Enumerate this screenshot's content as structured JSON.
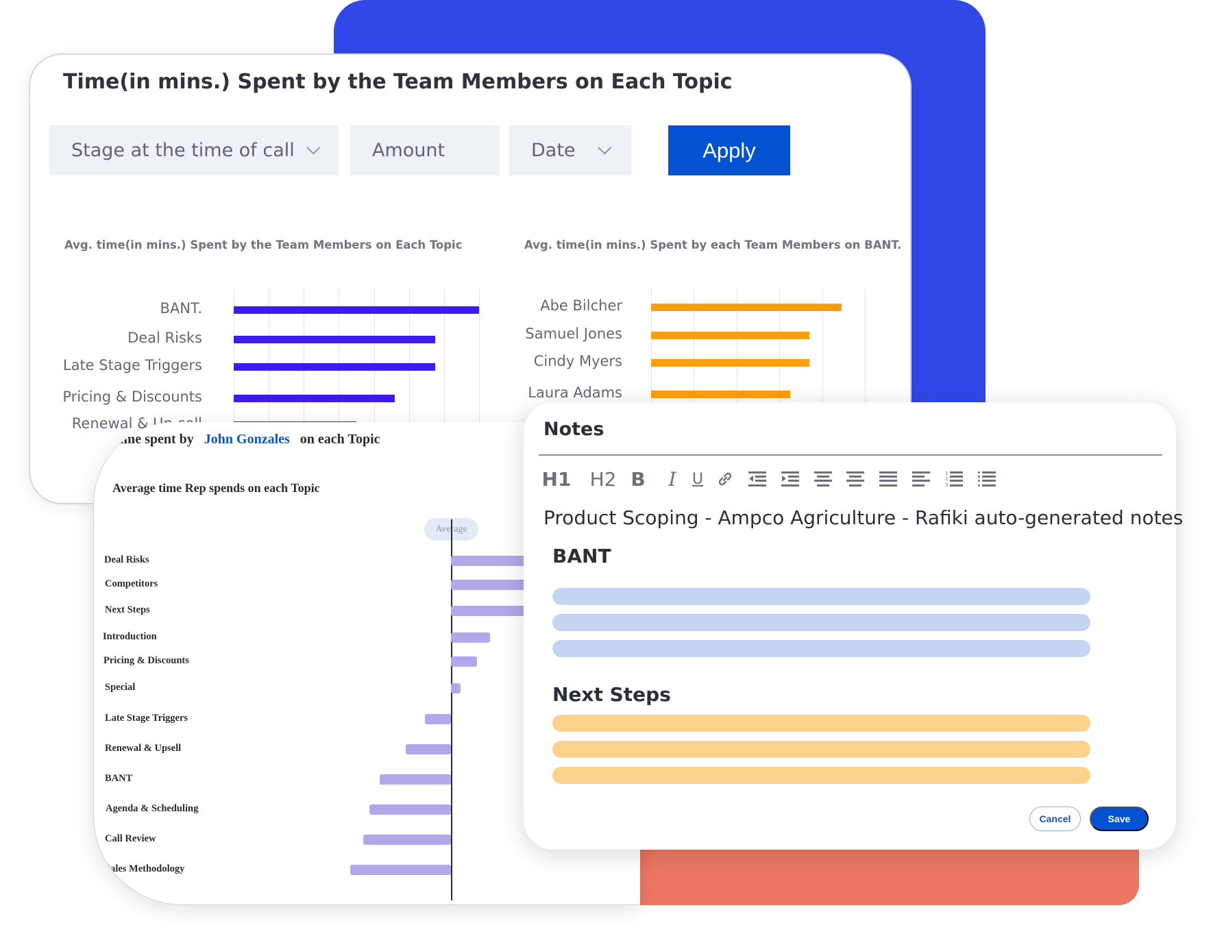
{
  "colors": {
    "bg_blue": "#3048e8",
    "bg_coral": "#ec7864",
    "topic_bar": "#3d1af0",
    "member_bar": "#fd9d10",
    "rep_bar": "#b1a8ea",
    "primary_button": "#0352d1",
    "highlight_name": "#0b56b8",
    "placeholder_blue": "#c6d4f4",
    "placeholder_orange": "#fdd28c"
  },
  "top_card": {
    "title": "Time(in mins.) Spent by the Team Members on Each Topic",
    "filters": [
      {
        "label": "Stage at the time of call",
        "has_dropdown": true
      },
      {
        "label": "Amount",
        "has_dropdown": false
      },
      {
        "label": "Date",
        "has_dropdown": true
      }
    ],
    "apply_label": "Apply"
  },
  "chart_data": [
    {
      "type": "bar",
      "orientation": "horizontal",
      "title": "Avg. time(in mins.) Spent by the Team Members on Each Topic",
      "categories": [
        "BANT.",
        "Deal Risks",
        "Late Stage Triggers",
        "Pricing & Discounts",
        "Renewal & Up-sell"
      ],
      "values": [
        7.0,
        5.75,
        5.75,
        4.6,
        3.5
      ],
      "xlim": [
        0,
        7
      ],
      "grid": true,
      "grid_intervals": 7,
      "color": "#3d1af0",
      "xlabel": "",
      "ylabel": ""
    },
    {
      "type": "bar",
      "orientation": "horizontal",
      "title": "Avg. time(in mins.) Spent by each Team Members on BANT.",
      "categories": [
        "Abe Bilcher",
        "Samuel Jones",
        "Cindy Myers",
        "Laura Adams"
      ],
      "values": [
        4.45,
        3.7,
        3.7,
        3.25
      ],
      "xlim": [
        0,
        5
      ],
      "grid": true,
      "grid_intervals": 5,
      "color": "#fd9d10",
      "xlabel": "",
      "ylabel": ""
    },
    {
      "type": "bar",
      "orientation": "horizontal-diverging",
      "title": "Average time Rep spends on each Topic",
      "reference_label": "Average",
      "categories": [
        "Deal Risks",
        "Competitors",
        "Next Steps",
        "Introduction",
        "Pricing & Discounts",
        "Special",
        "Late Stage Triggers",
        "Renewal & Upsell",
        "BANT",
        "Agenda & Scheduling",
        "Call Review",
        "Sales Methodology"
      ],
      "values": [
        1.6,
        1.6,
        1.6,
        0.6,
        0.4,
        0.15,
        -0.4,
        -0.7,
        -1.1,
        -1.25,
        -1.35,
        -1.55
      ],
      "xlim": [
        -2,
        2
      ],
      "grid": false,
      "color": "#b1a8ea"
    }
  ],
  "rep_card": {
    "title_prefix": "Time spent by",
    "rep_name": "John Gonzales",
    "title_suffix": "on each Topic"
  },
  "notes": {
    "title": "Notes",
    "toolbar": [
      {
        "label": "H1",
        "icon": "heading-1-icon"
      },
      {
        "label": "H2",
        "icon": "heading-2-icon"
      },
      {
        "label": "B",
        "icon": "bold-icon"
      },
      {
        "label": "I",
        "icon": "italic-icon"
      },
      {
        "label": "U",
        "icon": "underline-icon"
      },
      {
        "label": "",
        "icon": "link-icon"
      },
      {
        "label": "",
        "icon": "outdent-icon"
      },
      {
        "label": "",
        "icon": "indent-icon"
      },
      {
        "label": "",
        "icon": "align-right-icon"
      },
      {
        "label": "",
        "icon": "align-center-icon"
      },
      {
        "label": "",
        "icon": "align-justify-icon"
      },
      {
        "label": "",
        "icon": "align-left-icon"
      },
      {
        "label": "",
        "icon": "numbered-list-icon"
      },
      {
        "label": "",
        "icon": "bulleted-list-icon"
      }
    ],
    "doc_title": "Product Scoping - Ampco Agriculture - Rafiki auto-generated notes",
    "sections": [
      {
        "heading": "BANT",
        "placeholder_lines": 3,
        "color": "blue"
      },
      {
        "heading": "Next Steps",
        "placeholder_lines": 3,
        "color": "orange"
      }
    ],
    "cancel_label": "Cancel",
    "save_label": "Save"
  }
}
